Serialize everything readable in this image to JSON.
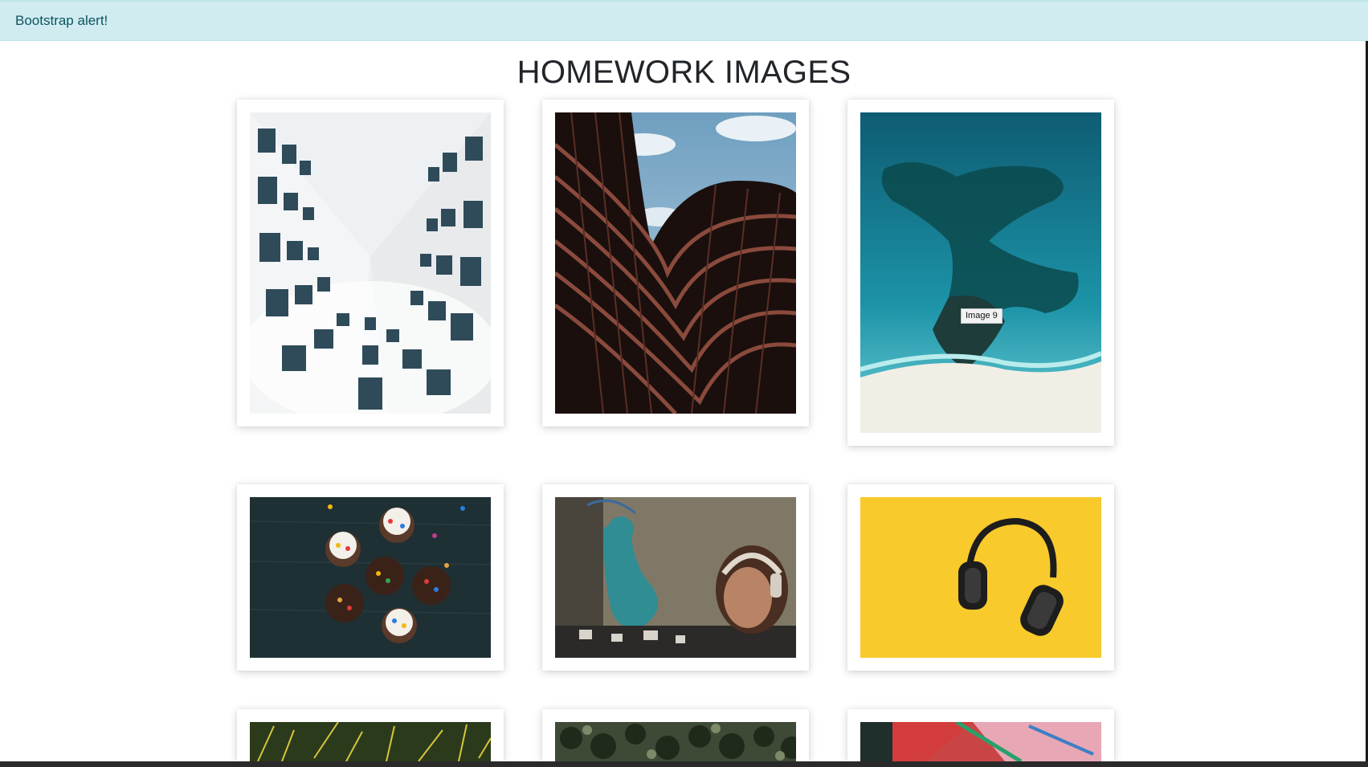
{
  "alert": {
    "text": "Bootstrap alert!"
  },
  "header": {
    "title": "HOMEWORK IMAGES"
  },
  "gallery": {
    "tooltip": "Image 9",
    "images": [
      {
        "subject": "white building looking up"
      },
      {
        "subject": "curved red facade with sky"
      },
      {
        "subject": "aerial turquoise coast"
      },
      {
        "subject": "cupcakes on dark wood"
      },
      {
        "subject": "street art with headphones"
      },
      {
        "subject": "headphones on yellow"
      },
      {
        "subject": "palm leaves"
      },
      {
        "subject": "palm trees aerial"
      },
      {
        "subject": "graffiti wall"
      }
    ]
  },
  "colors": {
    "alert_bg": "#d1ecf1",
    "alert_text": "#0c5460",
    "card_bg": "#ffffff"
  }
}
